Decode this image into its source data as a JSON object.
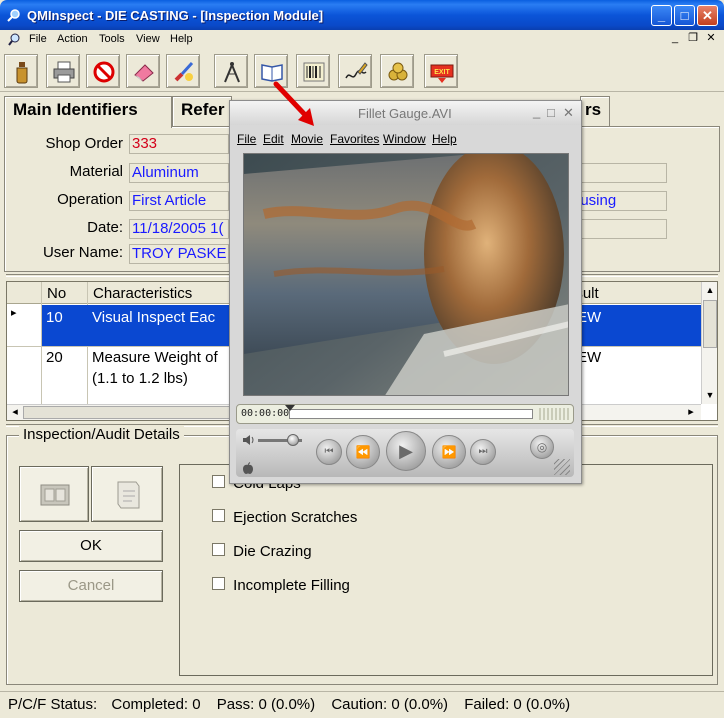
{
  "window": {
    "title": "QMInspect - DIE CASTING - [Inspection Module]",
    "min_glyph": "_",
    "max_glyph": "□",
    "close_glyph": "✕"
  },
  "menu": {
    "items": [
      "File",
      "Action",
      "Tools",
      "View",
      "Help"
    ],
    "mdi_min": "_",
    "mdi_restore": "❐",
    "mdi_close": "✕"
  },
  "toolbar": {
    "buttons": [
      {
        "name": "bottle-icon"
      },
      {
        "name": "printer-icon"
      },
      {
        "name": "no-entry-icon"
      },
      {
        "name": "eraser-icon"
      },
      {
        "name": "paint-brush-icon"
      },
      {
        "name": "drafting-compass-icon"
      },
      {
        "name": "book-icon"
      },
      {
        "name": "barcode-icon"
      },
      {
        "name": "signature-pen-icon"
      },
      {
        "name": "gears-icon"
      },
      {
        "name": "exit-icon",
        "label": "EXIT"
      }
    ]
  },
  "tabs": {
    "main_identifiers": "Main Identifiers",
    "references": "Refer",
    "right_tab_fragment": "rs"
  },
  "identifiers": {
    "shop_order_label": "Shop Order",
    "shop_order": "333",
    "material_label": "Material",
    "material": "Aluminum",
    "operation_label": "Operation",
    "operation": "First Article",
    "operation_right": "ousing",
    "date_label": "Date:",
    "date": "11/18/2005 1(",
    "user_name_label": "User Name:",
    "user_name": "TROY PASKE"
  },
  "grid": {
    "columns": {
      "no": "No",
      "characteristics": "Characteristics",
      "result": "esult"
    },
    "rows": [
      {
        "no": "10",
        "characteristic": "Visual Inspect Eac",
        "result": "EW",
        "selected": true
      },
      {
        "no": "20",
        "characteristic": "Measure Weight of",
        "characteristic_line2": "(1.1 to 1.2 lbs)",
        "result": "EW",
        "selected": false
      }
    ],
    "row_pointer": "▸",
    "scroll_up": "▲",
    "scroll_down": "▼",
    "scroll_left": "◂",
    "scroll_right": "▸"
  },
  "details": {
    "title": "Inspection/Audit Details",
    "ok_label": "OK",
    "cancel_label": "Cancel",
    "checks": [
      {
        "label": "Cold Laps",
        "checked": false
      },
      {
        "label": "Ejection Scratches",
        "checked": false
      },
      {
        "label": "Die Crazing",
        "checked": false
      },
      {
        "label": "Incomplete Filling",
        "checked": false
      }
    ]
  },
  "status": {
    "prefix": "P/C/F Status:",
    "completed": "Completed: 0",
    "pass": "Pass: 0 (0.0%)",
    "caution": "Caution: 0 (0.0%)",
    "failed": "Failed: 0 (0.0%)"
  },
  "movie_window": {
    "title": "Fillet Gauge.AVI",
    "title_min": "_",
    "title_max": "□",
    "title_close": "✕",
    "menu": [
      "File",
      "Edit",
      "Movie",
      "Favorites",
      "Window",
      "Help"
    ],
    "timecode": "00:00:00",
    "play_progress": 0.0,
    "volume_level": 0.8
  },
  "colors": {
    "titlebar_blue": "#0b55d9",
    "selected_row": "#0a48d1",
    "value_blue": "#1a1aff",
    "shop_order_red": "#d4001a",
    "annotation_arrow": "#e00000"
  }
}
